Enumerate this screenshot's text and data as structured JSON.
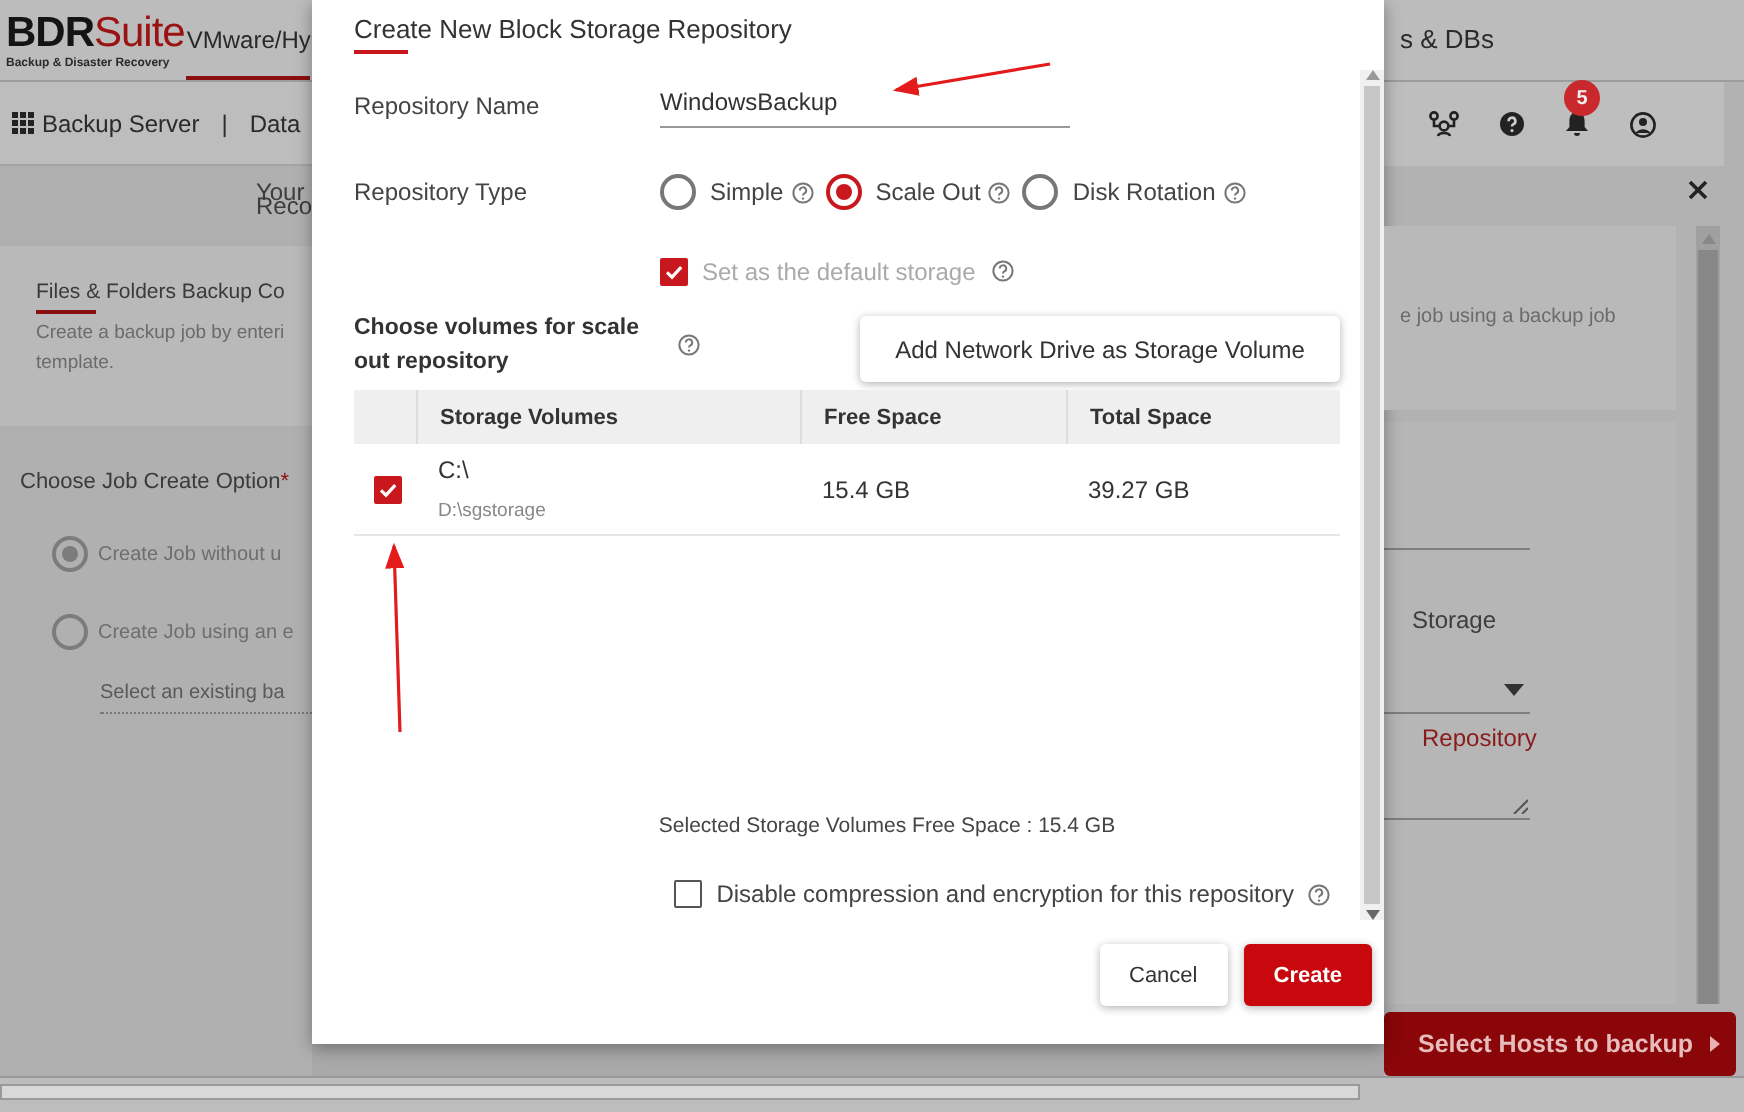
{
  "background": {
    "logo": {
      "brand_dark": "BDR",
      "brand_accent": "Suite",
      "tagline": "Backup & Disaster Recovery"
    },
    "product_tabs": [
      {
        "label": "VMware/Hy",
        "selected": true
      },
      {
        "label": "s & DBs",
        "selected": false
      }
    ],
    "server_menu": "Backup Server",
    "toolbar_separator": "|",
    "toolbar_tab": "Data",
    "notification_count": "5",
    "banner": [
      "Your",
      "Reco"
    ],
    "job_card": {
      "title": "Files & Folders Backup Co",
      "description_left": [
        "Create a backup job by enteri",
        "template."
      ],
      "description_right": "e job using a backup job"
    },
    "job_create_option": {
      "label": "Choose Job Create Option",
      "required_mark": "*",
      "options": [
        {
          "label": "Create Job without u",
          "selected": true
        },
        {
          "label": "Create Job using an e",
          "selected": false
        }
      ],
      "template_placeholder": "Select an existing ba"
    },
    "storage_label": "Storage",
    "repository_link": "Repository",
    "next_button": "Select Hosts to backup"
  },
  "dialog": {
    "title": "Create New Block Storage Repository",
    "name_field": {
      "label": "Repository Name",
      "value": "WindowsBackup"
    },
    "type_field": {
      "label": "Repository Type",
      "options": [
        {
          "label": "Simple",
          "selected": false
        },
        {
          "label": "Scale Out",
          "selected": true
        },
        {
          "label": "Disk Rotation",
          "selected": false
        }
      ]
    },
    "default_storage": {
      "label": "Set as the default storage",
      "checked": true,
      "disabled": true
    },
    "volumes": {
      "label": "Choose volumes for scale out repository",
      "add_button": "Add Network Drive as Storage Volume",
      "columns": [
        "Storage Volumes",
        "Free Space",
        "Total Space"
      ],
      "rows": [
        {
          "checked": true,
          "volume": "C:\\",
          "path": "D:\\sgstorage",
          "free_space": "15.4 GB",
          "total_space": "39.27 GB"
        }
      ]
    },
    "summary": "Selected Storage Volumes Free Space : 15.4 GB",
    "disable_compression": {
      "label": "Disable compression and encryption for this repository",
      "checked": false
    },
    "buttons": [
      {
        "label": "Cancel",
        "kind": "secondary"
      },
      {
        "label": "Create",
        "kind": "primary"
      }
    ]
  }
}
